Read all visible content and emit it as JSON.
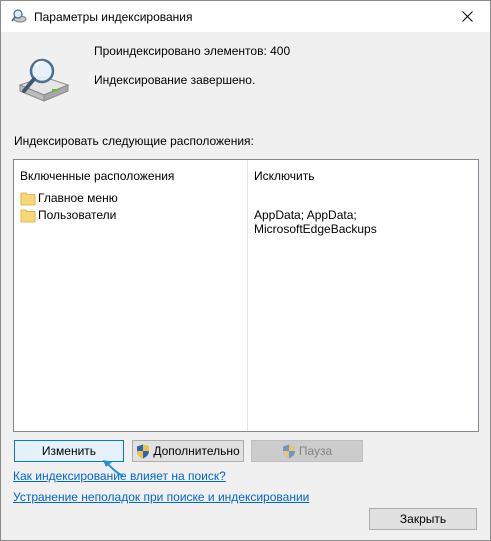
{
  "window": {
    "title": "Параметры индексирования"
  },
  "status": {
    "indexed_count": "Проиндексировано элементов: 400",
    "state": "Индексирование завершено."
  },
  "locations_label": "Индексировать следующие расположения:",
  "table": {
    "col_included": "Включенные расположения",
    "col_exclude": "Исключить",
    "rows": [
      {
        "included": "Главное меню",
        "exclude": ""
      },
      {
        "included": "Пользователи",
        "exclude": "AppData; AppData; MicrosoftEdgeBackups"
      }
    ]
  },
  "buttons": {
    "modify": "Изменить",
    "advanced": "Дополнительно",
    "pause": "Пауза",
    "close": "Закрыть"
  },
  "links": {
    "how_affects": "Как индексирование влияет на поиск?",
    "troubleshoot": "Устранение неполадок при поиске и индексировании"
  },
  "colors": {
    "accent": "#0078d7",
    "link": "#0066cc",
    "folder": "#f8d775"
  }
}
